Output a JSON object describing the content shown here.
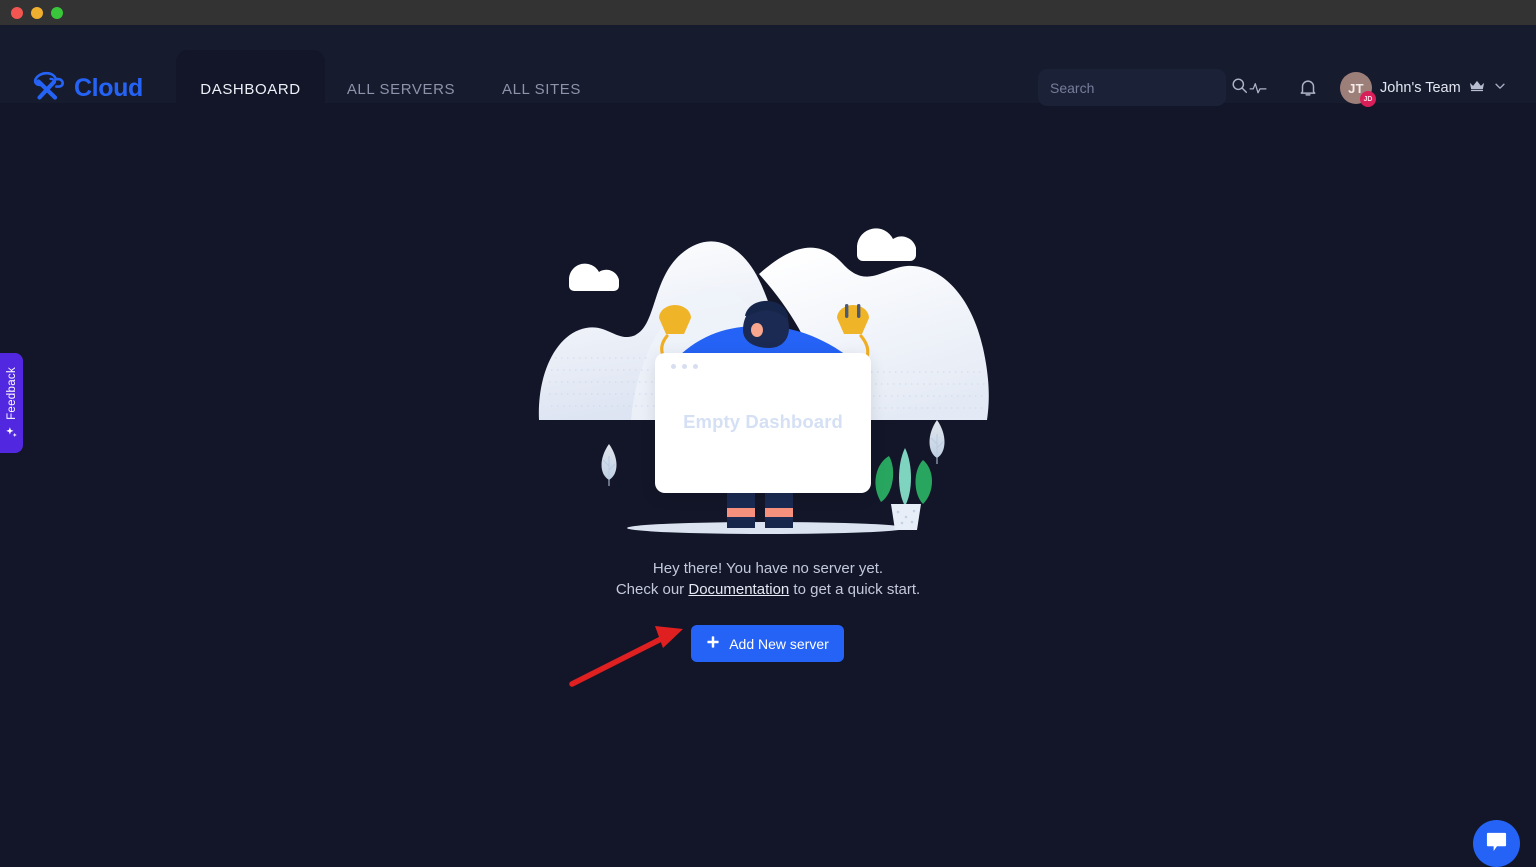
{
  "window": {
    "traffic_lights": [
      "close",
      "minimize",
      "maximize"
    ]
  },
  "brand": {
    "name": "Cloud",
    "logo_icon": "cloud-x-logo",
    "accent_color": "#2563f6"
  },
  "nav": {
    "tabs": [
      {
        "label": "DASHBOARD",
        "active": true
      },
      {
        "label": "ALL SERVERS",
        "active": false
      },
      {
        "label": "ALL SITES",
        "active": false
      }
    ]
  },
  "search": {
    "placeholder": "Search",
    "value": "",
    "icon": "search-icon"
  },
  "header_icons": [
    {
      "name": "activity-icon"
    },
    {
      "name": "notifications-bell-icon"
    }
  ],
  "account": {
    "avatar_initials": "JT",
    "badge_initials": "JD",
    "badge_color": "#d81f5a",
    "team_name": "John's Team",
    "crown_icon": "crown-icon",
    "chevron_icon": "chevron-down-icon"
  },
  "feedback": {
    "label": "Feedback",
    "icon": "sparkle-icon",
    "color": "#5128e0"
  },
  "empty_state": {
    "illustration": "empty-dashboard-illustration",
    "card_text": "Empty Dashboard",
    "line1": "Hey there! You have no server yet.",
    "line2_prefix": "Check our ",
    "line2_link": "Documentation",
    "line2_suffix": " to get a quick start.",
    "button_label": "Add New server",
    "button_icon": "plus-icon",
    "button_color": "#2563f6"
  },
  "annotation": {
    "arrow": "red-arrow-pointing-to-add-new-server",
    "color": "#e02020"
  },
  "chat": {
    "icon": "chat-bubble-icon",
    "color": "#2563f6"
  }
}
